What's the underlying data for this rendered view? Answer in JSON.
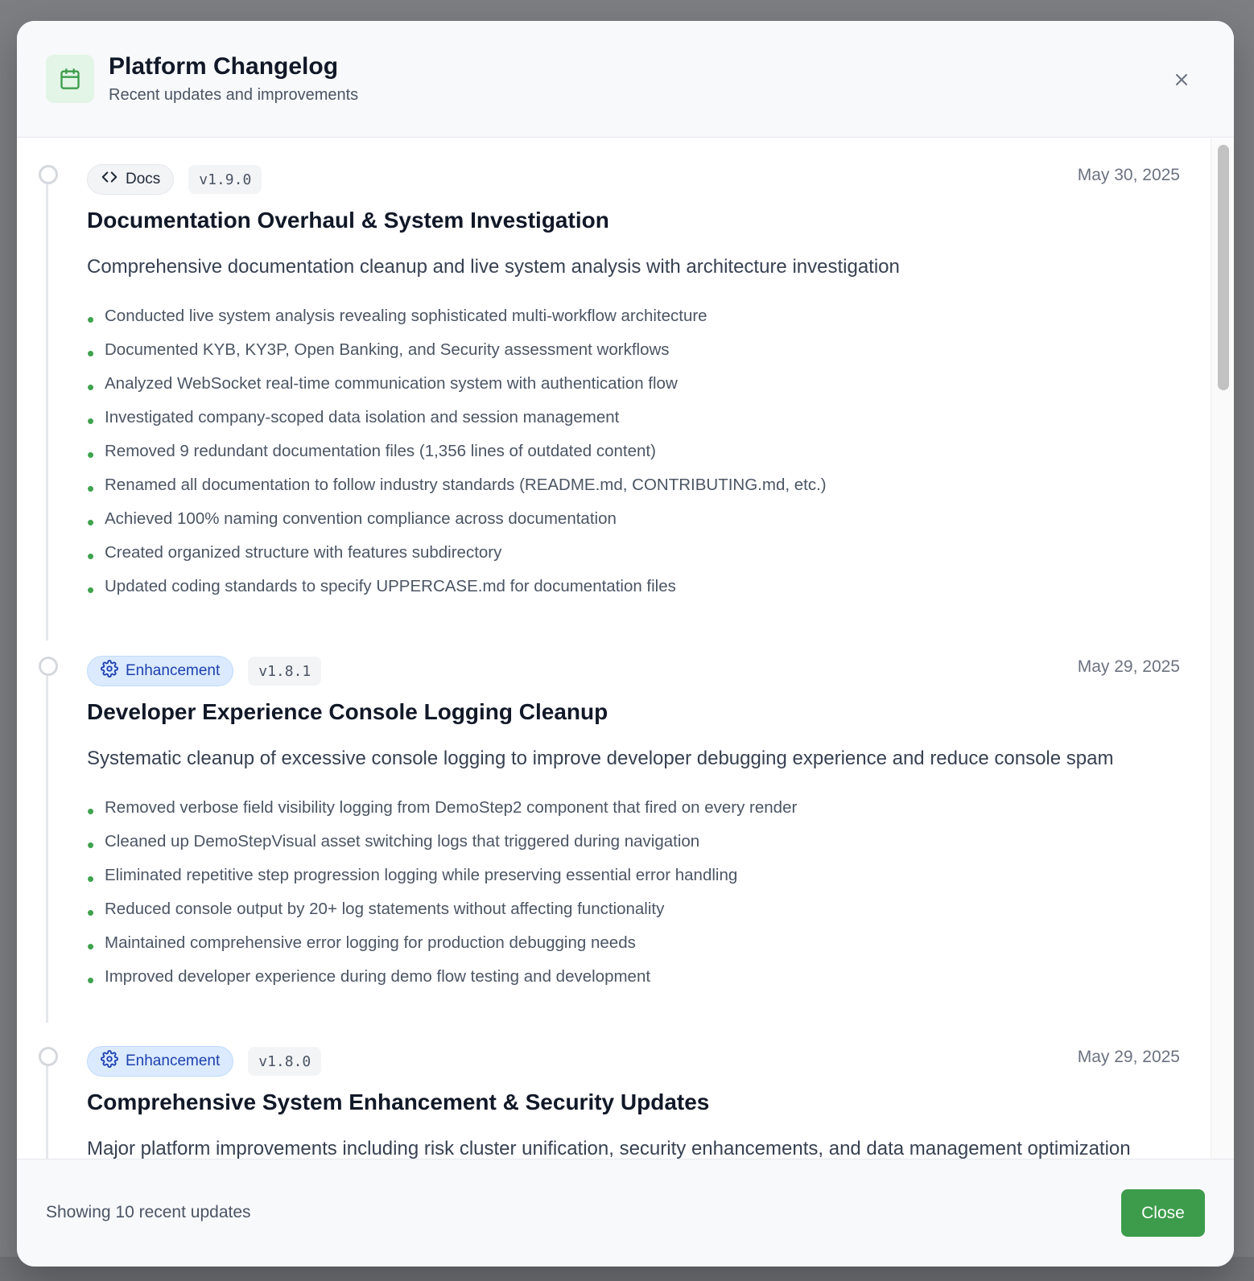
{
  "header": {
    "icon": "calendar-icon",
    "title": "Platform Changelog",
    "subtitle": "Recent updates and improvements",
    "close_icon": "close-icon"
  },
  "entries": [
    {
      "badge": {
        "label": "Docs",
        "icon": "code-icon",
        "variant": "docs"
      },
      "version": "v1.9.0",
      "date": "May 30, 2025",
      "title": "Documentation Overhaul & System Investigation",
      "description": "Comprehensive documentation cleanup and live system analysis with architecture investigation",
      "items": [
        "Conducted live system analysis revealing sophisticated multi-workflow architecture",
        "Documented KYB, KY3P, Open Banking, and Security assessment workflows",
        "Analyzed WebSocket real-time communication system with authentication flow",
        "Investigated company-scoped data isolation and session management",
        "Removed 9 redundant documentation files (1,356 lines of outdated content)",
        "Renamed all documentation to follow industry standards (README.md, CONTRIBUTING.md, etc.)",
        "Achieved 100% naming convention compliance across documentation",
        "Created organized structure with features subdirectory",
        "Updated coding standards to specify UPPERCASE.md for documentation files"
      ]
    },
    {
      "badge": {
        "label": "Enhancement",
        "icon": "gear-icon",
        "variant": "enhancement"
      },
      "version": "v1.8.1",
      "date": "May 29, 2025",
      "title": "Developer Experience Console Logging Cleanup",
      "description": "Systematic cleanup of excessive console logging to improve developer debugging experience and reduce console spam",
      "items": [
        "Removed verbose field visibility logging from DemoStep2 component that fired on every render",
        "Cleaned up DemoStepVisual asset switching logs that triggered during navigation",
        "Eliminated repetitive step progression logging while preserving essential error handling",
        "Reduced console output by 20+ log statements without affecting functionality",
        "Maintained comprehensive error logging for production debugging needs",
        "Improved developer experience during demo flow testing and development"
      ]
    },
    {
      "badge": {
        "label": "Enhancement",
        "icon": "gear-icon",
        "variant": "enhancement"
      },
      "version": "v1.8.0",
      "date": "May 29, 2025",
      "title": "Comprehensive System Enhancement & Security Updates",
      "description": "Major platform improvements including risk cluster unification, security enhancements, and data management optimization",
      "items": []
    }
  ],
  "footer": {
    "status_text": "Showing 10 recent updates",
    "close_label": "Close"
  },
  "colors": {
    "accent_green": "#3d9c4c",
    "enhancement_blue": "#1e40af",
    "bullet_green": "#3fa34d"
  }
}
